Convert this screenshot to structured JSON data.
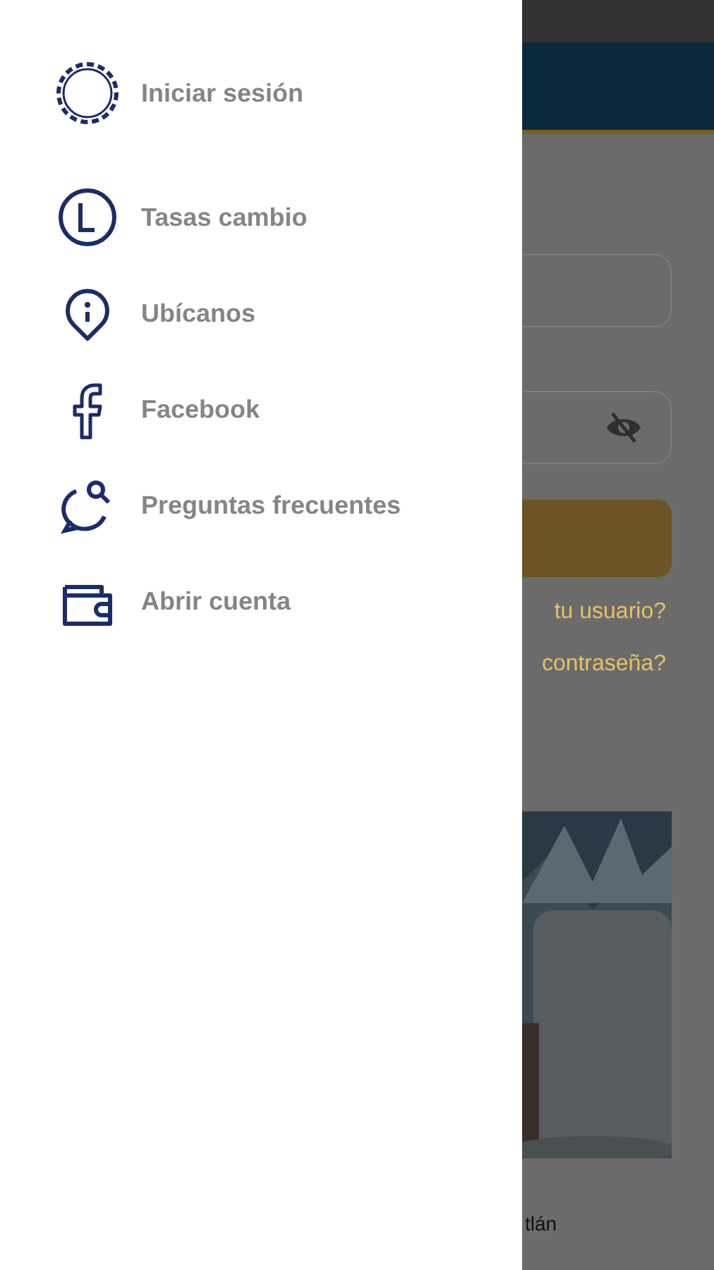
{
  "drawer": {
    "items": [
      {
        "label": "Iniciar sesión"
      },
      {
        "label": "Tasas cambio"
      },
      {
        "label": "Ubícanos"
      },
      {
        "label": "Facebook"
      },
      {
        "label": "Preguntas frecuentes"
      },
      {
        "label": "Abrir cuenta"
      }
    ]
  },
  "background": {
    "links": [
      "tu usuario?",
      "contraseña?"
    ],
    "footer_text": "tlán"
  }
}
